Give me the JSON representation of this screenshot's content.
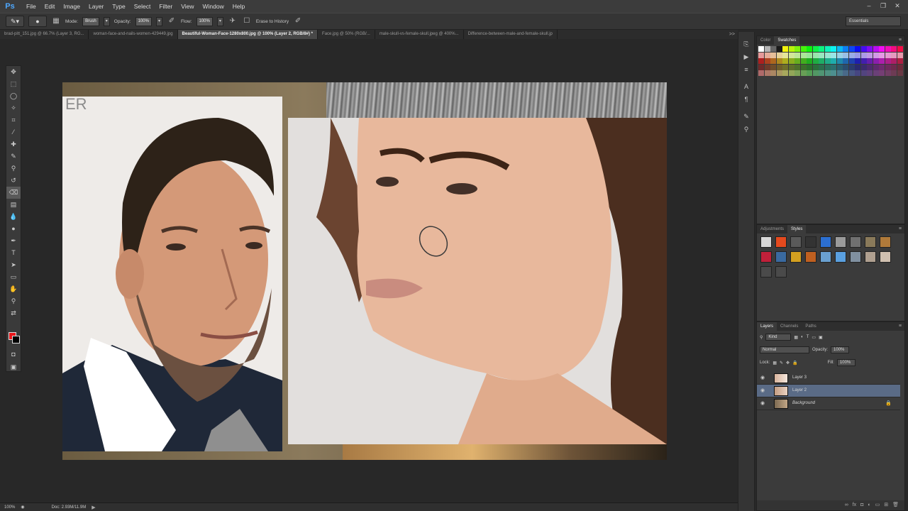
{
  "app": {
    "logo": "Ps"
  },
  "menu": [
    "File",
    "Edit",
    "Image",
    "Layer",
    "Type",
    "Select",
    "Filter",
    "View",
    "Window",
    "Help"
  ],
  "window_controls": {
    "minimize": "–",
    "restore": "❐",
    "close": "✕"
  },
  "options": {
    "mode_label": "Mode:",
    "mode_value": "Brush",
    "opacity_label": "Opacity:",
    "opacity_value": "100%",
    "flow_label": "Flow:",
    "flow_value": "100%",
    "erase_history_label": "Erase to History",
    "workspace": "Essentials"
  },
  "tabs": [
    {
      "label": "brad-pitt_151.jpg @ 66.7% (Layer 3, RG...",
      "active": false
    },
    {
      "label": "woman-face-and-nails-women-429449.jpg",
      "active": false
    },
    {
      "label": "Beautiful-Woman-Face-1280x800.jpg @ 100% (Layer 2, RGB/8#) *",
      "active": true
    },
    {
      "label": "Face.jpg @ 50% (RGB/...",
      "active": false
    },
    {
      "label": "male-skull-vs-female-skull.jpeg @ 400%...",
      "active": false
    },
    {
      "label": "Difference-between-male-and-female-skull.jp",
      "active": false
    }
  ],
  "tabs_more": ">>",
  "colors": {
    "foreground": "#e8161b",
    "background": "#000000",
    "accent": "#5a6b86"
  },
  "panels": {
    "swatches": {
      "tabs": [
        "Color",
        "Swatches"
      ],
      "active": "Swatches"
    },
    "styles": {
      "tabs": [
        "Adjustments",
        "Styles"
      ],
      "active": "Styles"
    },
    "layers": {
      "tabs": [
        "Layers",
        "Channels",
        "Paths"
      ],
      "active": "Layers",
      "kind_label": "Kind",
      "blend_mode": "Normal",
      "opacity_label": "Opacity:",
      "opacity_value": "100%",
      "lock_label": "Lock:",
      "fill_label": "Fill:",
      "fill_value": "100%",
      "layers": [
        {
          "name": "Layer 3",
          "selected": false,
          "locked": false
        },
        {
          "name": "Layer 2",
          "selected": true,
          "locked": false
        },
        {
          "name": "Background",
          "selected": false,
          "locked": true
        }
      ],
      "footer_icons": [
        "link-icon",
        "fx-icon",
        "mask-icon",
        "adjustment-icon",
        "folder-icon",
        "new-layer-icon",
        "trash-icon"
      ]
    }
  },
  "status": {
    "zoom": "100%",
    "doc": "Doc: 2.93M/11.9M"
  }
}
